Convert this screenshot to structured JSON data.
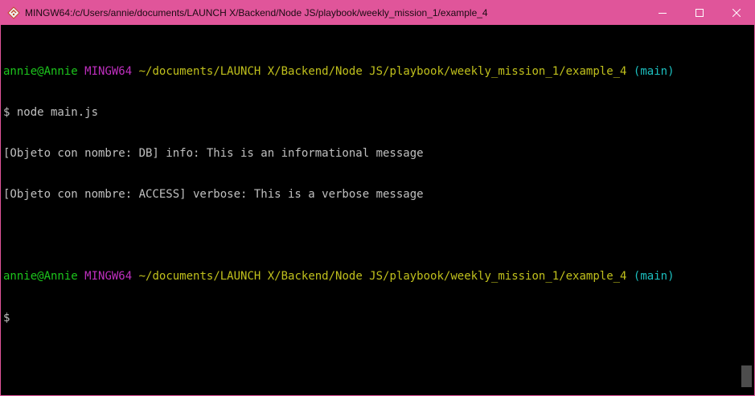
{
  "window": {
    "title": "MINGW64:/c/Users/annie/documents/LAUNCH X/Backend/Node JS/playbook/weekly_mission_1/example_4",
    "title_color": "#e0559a",
    "controls": {
      "minimize_icon": "minimize-icon",
      "maximize_icon": "maximize-icon",
      "close_icon": "close-icon"
    }
  },
  "terminal": {
    "prompt1": {
      "user": "annie@Annie",
      "system": "MINGW64",
      "path": "~/documents/LAUNCH X/Backend/Node JS/playbook/weekly_mission_1/example_4",
      "branch": "(main)"
    },
    "command1": "$ node main.js",
    "output": [
      "[Objeto con nombre: DB] info: This is an informational message",
      "[Objeto con nombre: ACCESS] verbose: This is a verbose message"
    ],
    "prompt2": {
      "user": "annie@Annie",
      "system": "MINGW64",
      "path": "~/documents/LAUNCH X/Backend/Node JS/playbook/weekly_mission_1/example_4",
      "branch": "(main)"
    },
    "command2": "$",
    "colors": {
      "user": "#1cc51c",
      "system": "#bf2fbf",
      "path": "#c0c01c",
      "branch": "#1cbfbf",
      "text": "#c0c0c0",
      "background": "#000000"
    }
  }
}
